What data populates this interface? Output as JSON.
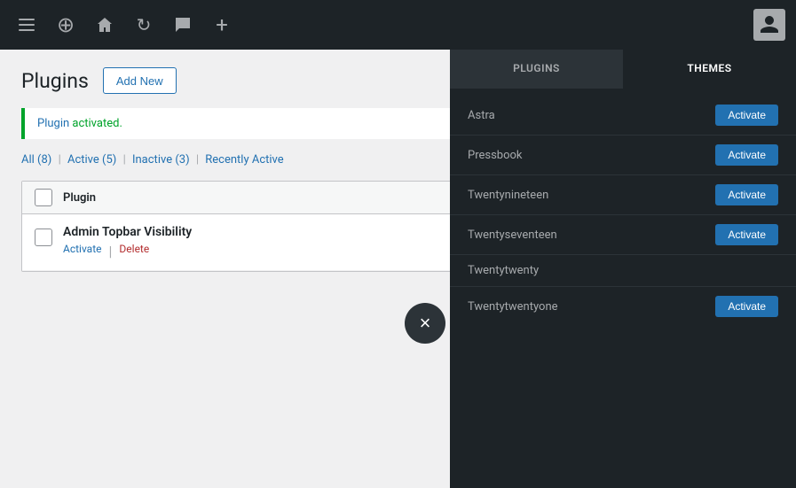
{
  "adminBar": {
    "icons": [
      "menu",
      "wordpress",
      "home",
      "sync",
      "comment",
      "add"
    ],
    "avatarAlt": "User avatar"
  },
  "pluginsPage": {
    "title": "Plugins",
    "addNewLabel": "Add New",
    "notice": {
      "plugin": "Plugin",
      "text": " activated."
    },
    "filterLinks": {
      "all": "All",
      "allCount": "(8)",
      "active": "Active",
      "activeCount": "(5)",
      "inactive": "Inactive",
      "inactiveCount": "(3)",
      "recentlyActive": "Recently Active"
    },
    "tableHeader": {
      "checkboxLabel": "",
      "pluginLabel": "Plugin"
    },
    "plugins": [
      {
        "name": "Admin Topbar Visibility",
        "actions": [
          {
            "label": "Activate",
            "type": "activate"
          },
          {
            "label": "Delete",
            "type": "delete"
          }
        ]
      }
    ]
  },
  "overlay": {
    "tabs": [
      {
        "label": "PLUGINS",
        "active": false
      },
      {
        "label": "THEMES",
        "active": true
      }
    ],
    "closeLabel": "×",
    "themes": [
      {
        "name": "Astra",
        "hasActivate": true
      },
      {
        "name": "Pressbook",
        "hasActivate": true
      },
      {
        "name": "Twentynineteen",
        "hasActivate": true
      },
      {
        "name": "Twentyseventeen",
        "hasActivate": true
      },
      {
        "name": "Twentytwenty",
        "hasActivate": false
      },
      {
        "name": "Twentytwentyone",
        "hasActivate": true
      }
    ],
    "activateLabel": "Activate"
  }
}
